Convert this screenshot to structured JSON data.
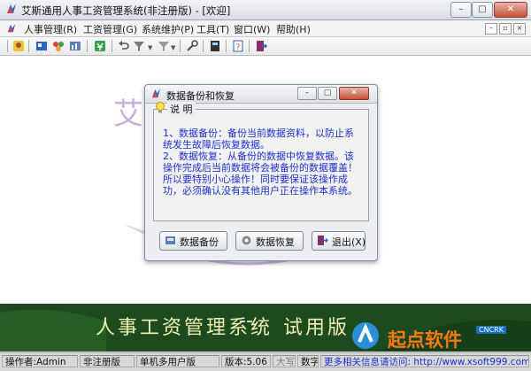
{
  "window": {
    "title": "艾斯通用人事工资管理系统(非注册版) - [欢迎]"
  },
  "menubar": {
    "items": [
      {
        "label": "人事管理(R)"
      },
      {
        "label": "工资管理(G)"
      },
      {
        "label": "系统维护(P)"
      },
      {
        "label": "工具(T)"
      },
      {
        "label": "窗口(W)"
      },
      {
        "label": "帮助(H)"
      }
    ]
  },
  "background": {
    "text": "艾"
  },
  "dialog": {
    "title": "数据备份和恢复",
    "info_label": "说 明",
    "info_text": "1、数据备份：备份当前数据资料，以防止系统发生故障后恢复数据。\n2、数据恢复：从备份的数据中恢复数据。该操作完成后当前数据将会被备份的数据覆盖！所以要特别小心操作！同时要保证该操作成功，必须确认没有其他用户正在操作本系统。",
    "buttons": {
      "backup": "数据备份",
      "restore": "数据恢复",
      "exit": "退出(X)"
    }
  },
  "banner": {
    "title": "人事工资管理系统",
    "dash": "--",
    "edition": "试用版"
  },
  "watermark": {
    "text": "起点软件",
    "tag": "CNCRK"
  },
  "statusbar": {
    "operator": "操作者:Admin",
    "registration": "非注册版",
    "mode": "单机多用户版",
    "version": "版本:5.06",
    "caps": "大写",
    "num": "数字",
    "info": "更多相关信息请访问: http://www.xsoft999.com"
  },
  "colors": {
    "accent_blue": "#1d2fd0",
    "banner_green": "#1d4a1f",
    "banner_text": "#f1f0b0",
    "watermark_orange": "#ff7a14"
  }
}
